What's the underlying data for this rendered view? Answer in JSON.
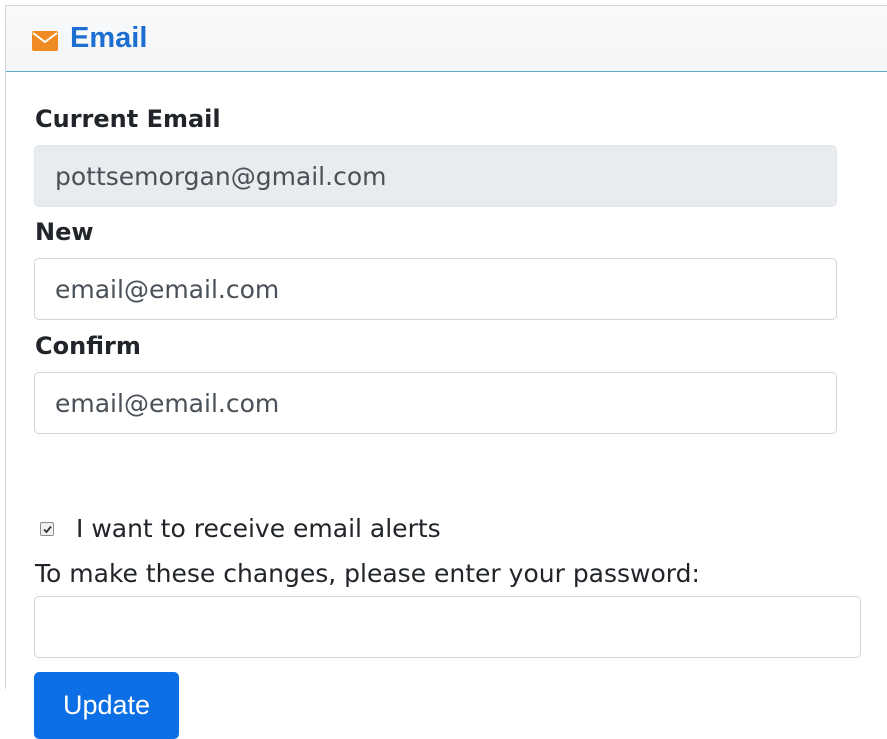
{
  "header": {
    "title": "Email",
    "icon": "envelope-icon",
    "icon_color": "#f08a22"
  },
  "current_email": {
    "label": "Current Email",
    "value": "pottsemorgan@gmail.com"
  },
  "new_email": {
    "label": "New",
    "placeholder": "email@email.com"
  },
  "confirm_email": {
    "label": "Confirm",
    "placeholder": "email@email.com"
  },
  "alerts": {
    "label": "I want to receive email alerts",
    "checked": true
  },
  "password": {
    "prompt": "To make these changes, please enter your password:",
    "value": ""
  },
  "update_button": {
    "label": "Update",
    "color": "#0d6fe6"
  },
  "colors": {
    "title": "#1c6fd1",
    "header_border": "#5eb0c9"
  }
}
